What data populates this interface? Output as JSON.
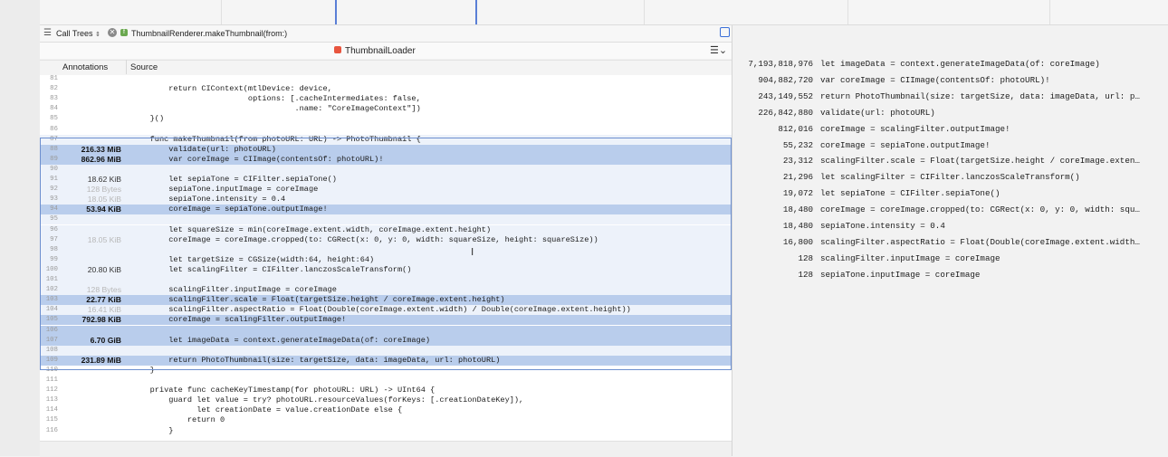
{
  "jump_bar": {
    "call_trees_label": "Call Trees",
    "chevron": "⌃",
    "function_label": "ThumbnailRenderer.makeThumbnail(from:)",
    "close_icon": "x-circle-icon",
    "function_icon": "function-icon",
    "sidebar_toggle_icon": "sidebar-toggle-icon"
  },
  "editor": {
    "file_title": "ThumbnailLoader",
    "file_icon": "swift-file-icon",
    "menu_icon": "editor-menu-icon",
    "columns": {
      "annotations": "Annotations",
      "source": "Source"
    }
  },
  "source_lines": [
    {
      "num": "81",
      "ann": "",
      "code": "",
      "state": ""
    },
    {
      "num": "82",
      "ann": "",
      "code": "        return CIContext(mtlDevice: device,",
      "state": ""
    },
    {
      "num": "83",
      "ann": "",
      "code": "                         options: [.cacheIntermediates: false,",
      "state": ""
    },
    {
      "num": "84",
      "ann": "",
      "code": "                                   .name: \"CoreImageContext\"])",
      "state": ""
    },
    {
      "num": "85",
      "ann": "",
      "code": "    }()",
      "state": ""
    },
    {
      "num": "86",
      "ann": "",
      "code": "",
      "state": ""
    },
    {
      "num": "87",
      "ann": "",
      "code": "    func makeThumbnail(from photoURL: URL) -> PhotoThumbnail {",
      "state": "sel"
    },
    {
      "num": "88",
      "ann": "216.33 MiB",
      "code": "        validate(url: photoURL)",
      "state": "hl"
    },
    {
      "num": "89",
      "ann": "862.96 MiB",
      "code": "        var coreImage = CIImage(contentsOf: photoURL)!",
      "state": "hl"
    },
    {
      "num": "90",
      "ann": "",
      "code": "",
      "state": "sel"
    },
    {
      "num": "91",
      "ann": "18.62 KiB",
      "code": "        let sepiaTone = CIFilter.sepiaTone()",
      "state": "sel"
    },
    {
      "num": "92",
      "ann": "128 Bytes",
      "code": "        sepiaTone.inputImage = coreImage",
      "state": "sel"
    },
    {
      "num": "93",
      "ann": "18.05 KiB",
      "code": "        sepiaTone.intensity = 0.4",
      "state": "sel"
    },
    {
      "num": "94",
      "ann": "53.94 KiB",
      "code": "        coreImage = sepiaTone.outputImage!",
      "state": "hl"
    },
    {
      "num": "95",
      "ann": "",
      "code": "",
      "state": "sel"
    },
    {
      "num": "96",
      "ann": "",
      "code": "        let squareSize = min(coreImage.extent.width, coreImage.extent.height)",
      "state": "sel"
    },
    {
      "num": "97",
      "ann": "18.05 KiB",
      "code": "        coreImage = coreImage.cropped(to: CGRect(x: 0, y: 0, width: squareSize, height: squareSize))",
      "state": "sel"
    },
    {
      "num": "98",
      "ann": "",
      "code": "",
      "state": "sel"
    },
    {
      "num": "99",
      "ann": "",
      "code": "        let targetSize = CGSize(width:64, height:64)",
      "state": "sel"
    },
    {
      "num": "100",
      "ann": "20.80 KiB",
      "code": "        let scalingFilter = CIFilter.lanczosScaleTransform()",
      "state": "sel"
    },
    {
      "num": "101",
      "ann": "",
      "code": "",
      "state": "sel"
    },
    {
      "num": "102",
      "ann": "128 Bytes",
      "code": "        scalingFilter.inputImage = coreImage",
      "state": "sel"
    },
    {
      "num": "103",
      "ann": "22.77 KiB",
      "code": "        scalingFilter.scale = Float(targetSize.height / coreImage.extent.height)",
      "state": "hl"
    },
    {
      "num": "104",
      "ann": "16.41 KiB",
      "code": "        scalingFilter.aspectRatio = Float(Double(coreImage.extent.width) / Double(coreImage.extent.height))",
      "state": "sel"
    },
    {
      "num": "105",
      "ann": "792.98 KiB",
      "code": "        coreImage = scalingFilter.outputImage!",
      "state": "hl"
    },
    {
      "num": "106",
      "ann": "",
      "code": "",
      "state": "hl"
    },
    {
      "num": "107",
      "ann": "6.70 GiB",
      "code": "        let imageData = context.generateImageData(of: coreImage)",
      "state": "hl"
    },
    {
      "num": "108",
      "ann": "",
      "code": "",
      "state": "sel"
    },
    {
      "num": "109",
      "ann": "231.89 MiB",
      "code": "        return PhotoThumbnail(size: targetSize, data: imageData, url: photoURL)",
      "state": "hl"
    },
    {
      "num": "110",
      "ann": "",
      "code": "    }",
      "state": ""
    },
    {
      "num": "111",
      "ann": "",
      "code": "",
      "state": ""
    },
    {
      "num": "112",
      "ann": "",
      "code": "    private func cacheKeyTimestamp(for photoURL: URL) -> UInt64 {",
      "state": ""
    },
    {
      "num": "113",
      "ann": "",
      "code": "        guard let value = try? photoURL.resourceValues(forKeys: [.creationDateKey]),",
      "state": ""
    },
    {
      "num": "114",
      "ann": "",
      "code": "              let creationDate = value.creationDate else {",
      "state": ""
    },
    {
      "num": "115",
      "ann": "",
      "code": "            return 0",
      "state": ""
    },
    {
      "num": "116",
      "ann": "",
      "code": "        }",
      "state": ""
    }
  ],
  "summary": [
    {
      "count": "7,193,818,976",
      "text": "let imageData = context.generateImageData(of: coreImage)"
    },
    {
      "count": "904,882,720",
      "text": "var coreImage = CIImage(contentsOf: photoURL)!"
    },
    {
      "count": "243,149,552",
      "text": "return PhotoThumbnail(size: targetSize, data: imageData, url: p…"
    },
    {
      "count": "226,842,880",
      "text": "validate(url: photoURL)"
    },
    {
      "count": "812,016",
      "text": "coreImage = scalingFilter.outputImage!"
    },
    {
      "count": "55,232",
      "text": "coreImage = sepiaTone.outputImage!"
    },
    {
      "count": "23,312",
      "text": "scalingFilter.scale = Float(targetSize.height / coreImage.exten…"
    },
    {
      "count": "21,296",
      "text": "let scalingFilter = CIFilter.lanczosScaleTransform()"
    },
    {
      "count": "19,072",
      "text": "let sepiaTone = CIFilter.sepiaTone()"
    },
    {
      "count": "18,480",
      "text": "coreImage = coreImage.cropped(to: CGRect(x: 0, y: 0, width: squ…"
    },
    {
      "count": "18,480",
      "text": "sepiaTone.intensity = 0.4"
    },
    {
      "count": "16,800",
      "text": "scalingFilter.aspectRatio = Float(Double(coreImage.extent.width…"
    },
    {
      "count": "128",
      "text": "scalingFilter.inputImage = coreImage"
    },
    {
      "count": "128",
      "text": "sepiaTone.inputImage = coreImage"
    }
  ],
  "colors": {
    "highlight": "#b9cdec",
    "selection": "#edf2fa",
    "selection_border": "#6d8fcf",
    "timeline_marker": "#5a7fd6"
  }
}
